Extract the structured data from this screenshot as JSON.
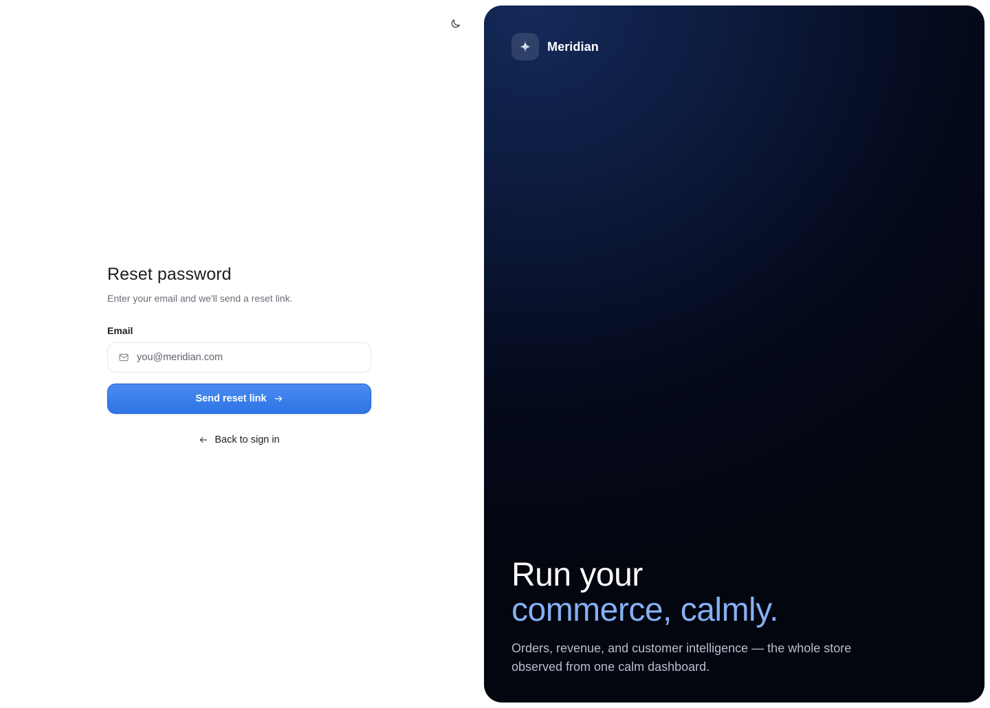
{
  "theme": {
    "icon": "moon-icon"
  },
  "form": {
    "title": "Reset password",
    "subtitle": "Enter your email and we'll send a reset link.",
    "email_label": "Email",
    "email_placeholder": "you@meridian.com",
    "email_value": "",
    "submit_label": "Send reset link",
    "back_label": "Back to sign in"
  },
  "brand": {
    "name": "Meridian",
    "logo_icon": "sparkle-icon"
  },
  "hero": {
    "line1": "Run your",
    "line2": "commerce, calmly.",
    "description": "Orders, revenue, and customer intelligence — the whole store observed from one calm dashboard."
  },
  "colors": {
    "accent": "#2f74e6",
    "hero_highlight": "#86b0f4",
    "panel_dark": "#050a1c"
  }
}
